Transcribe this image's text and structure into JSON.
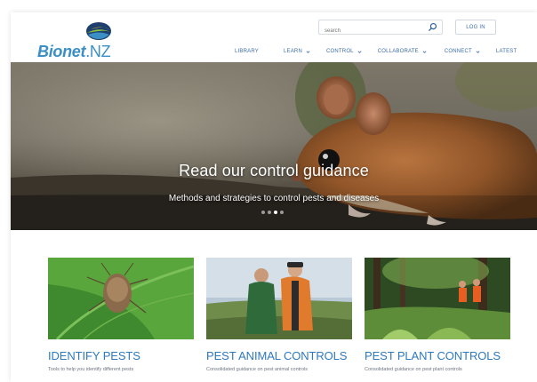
{
  "brand": {
    "name": "Bionet",
    "suffix": ".NZ"
  },
  "search": {
    "placeholder": "search"
  },
  "header": {
    "login_label": "LOG IN"
  },
  "nav": [
    {
      "label": "LIBRARY",
      "has_dropdown": false
    },
    {
      "label": "LEARN",
      "has_dropdown": true
    },
    {
      "label": "CONTROL",
      "has_dropdown": true
    },
    {
      "label": "COLLABORATE",
      "has_dropdown": true
    },
    {
      "label": "CONNECT",
      "has_dropdown": true
    },
    {
      "label": "LATEST",
      "has_dropdown": false
    }
  ],
  "hero": {
    "title": "Read our control guidance",
    "subtitle": "Methods and strategies to control pests and diseases",
    "slides": 4,
    "active_slide": 3
  },
  "cards": [
    {
      "title": "IDENTIFY PESTS",
      "description": "Tools to help you identify different pests"
    },
    {
      "title": "PEST ANIMAL CONTROLS",
      "description": "Consolidated guidance on pest animal controls"
    },
    {
      "title": "PEST PLANT CONTROLS",
      "description": "Consolidated guidance on pest plant controls"
    }
  ],
  "colors": {
    "accent": "#2f79bd",
    "nav": "#3d6ea8",
    "logo": "#3b8fc4"
  }
}
